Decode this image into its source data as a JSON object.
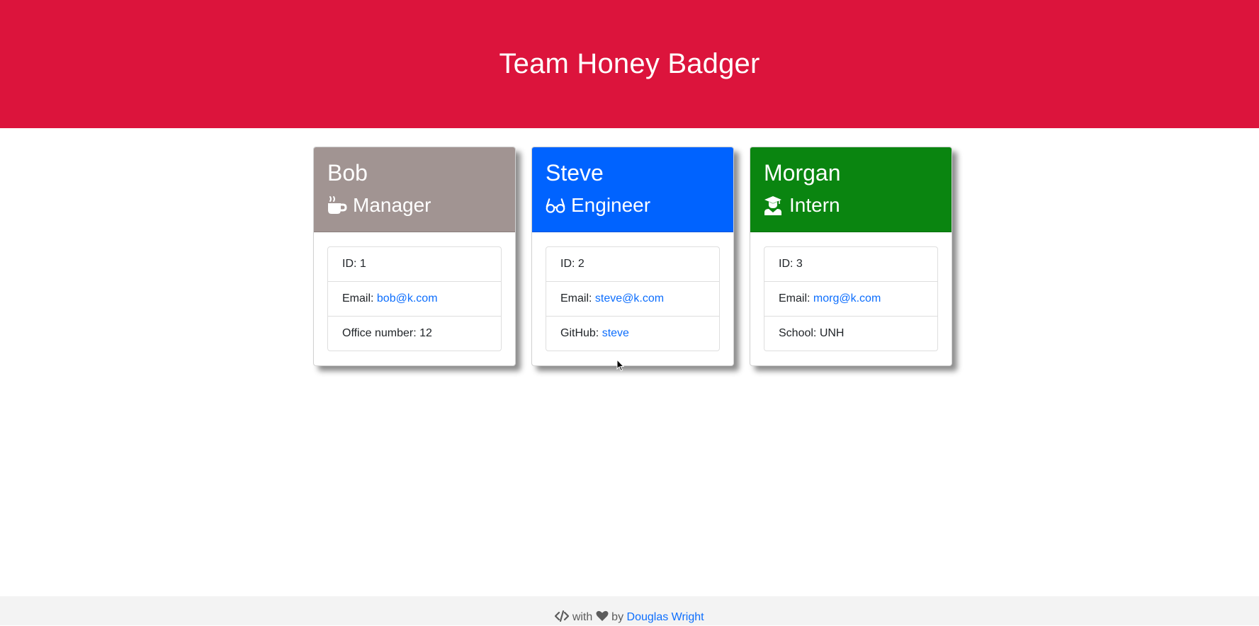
{
  "header": {
    "title": "Team Honey Badger"
  },
  "team": [
    {
      "name": "Bob",
      "role": "Manager",
      "icon": "mug-icon",
      "color": "#a19492",
      "id_label": "ID: 1",
      "email_label": "Email: ",
      "email": "bob@k.com",
      "extra_label": "Office number: 12",
      "extra_link": ""
    },
    {
      "name": "Steve",
      "role": "Engineer",
      "icon": "glasses-icon",
      "color": "#0063ff",
      "id_label": "ID: 2",
      "email_label": "Email: ",
      "email": "steve@k.com",
      "extra_label": "GitHub: ",
      "extra_link": "steve"
    },
    {
      "name": "Morgan",
      "role": "Intern",
      "icon": "graduate-icon",
      "color": "#0a8510",
      "id_label": "ID: 3",
      "email_label": "Email: ",
      "email": "morg@k.com",
      "extra_label": "School: UNH",
      "extra_link": ""
    }
  ],
  "footer": {
    "with_text": " with ",
    "by_text": " by ",
    "author": "Douglas Wright"
  }
}
